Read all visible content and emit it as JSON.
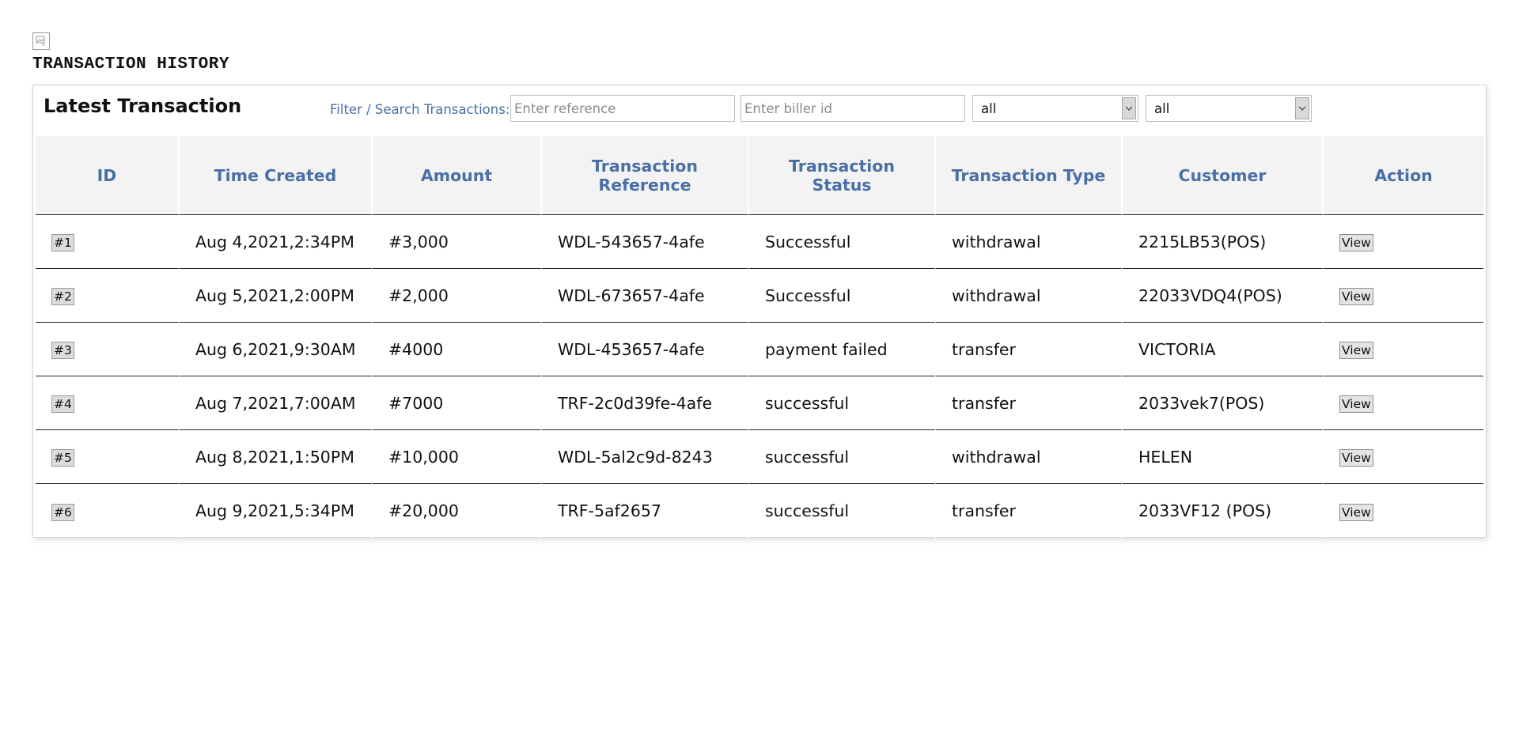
{
  "page": {
    "title": "TRANSACTION HISTORY",
    "broken_image_icon": "broken-image-icon"
  },
  "card": {
    "title": "Latest Transaction",
    "filter_label": "Filter / Search Transactions:",
    "reference_placeholder": "Enter reference",
    "biller_placeholder": "Enter biller id",
    "select_1_value": "all",
    "select_2_value": "all",
    "dropdown_icon": "chevron-down-icon"
  },
  "table": {
    "headers": [
      "ID",
      "Time Created",
      "Amount",
      "Transaction Reference",
      "Transaction Status",
      "Transaction Type",
      "Customer",
      "Action"
    ],
    "rows": [
      {
        "id": "#1",
        "time": "Aug 4,2021,2:34PM",
        "amount": "#3,000",
        "reference": "WDL-543657-4afe",
        "status": "Successful",
        "type": "withdrawal",
        "customer": "2215LB53(POS)",
        "action": "View"
      },
      {
        "id": "#2",
        "time": "Aug 5,2021,2:00PM",
        "amount": "#2,000",
        "reference": "WDL-673657-4afe",
        "status": "Successful",
        "type": "withdrawal",
        "customer": "22033VDQ4(POS)",
        "action": "View"
      },
      {
        "id": "#3",
        "time": "Aug 6,2021,9:30AM",
        "amount": "#4000",
        "reference": "WDL-453657-4afe",
        "status": "payment failed",
        "type": "transfer",
        "customer": "VICTORIA",
        "action": "View"
      },
      {
        "id": "#4",
        "time": "Aug 7,2021,7:00AM",
        "amount": "#7000",
        "reference": "TRF-2c0d39fe-4afe",
        "status": "successful",
        "type": "transfer",
        "customer": "2033vek7(POS)",
        "action": "View"
      },
      {
        "id": "#5",
        "time": "Aug 8,2021,1:50PM",
        "amount": "#10,000",
        "reference": "WDL-5al2c9d-8243",
        "status": "successful",
        "type": "withdrawal",
        "customer": "HELEN",
        "action": "View"
      },
      {
        "id": "#6",
        "time": "Aug 9,2021,5:34PM",
        "amount": "#20,000",
        "reference": "TRF-5af2657",
        "status": "successful",
        "type": "transfer",
        "customer": "2033VF12 (POS)",
        "action": "View"
      }
    ]
  },
  "colors": {
    "header_text": "#4a6fa5",
    "header_bg": "#f3f3f3"
  }
}
